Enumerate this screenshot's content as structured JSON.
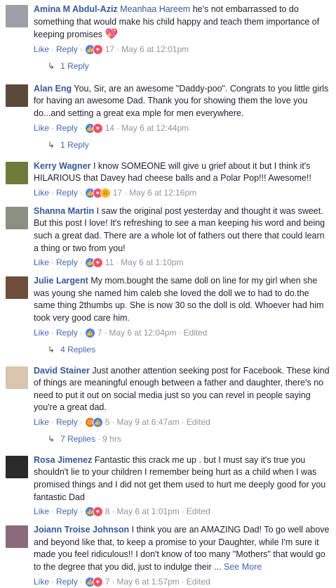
{
  "comments": [
    {
      "author": "Amina M Abdul-Aziz",
      "mention": "Meanhaa Hareem",
      "text": " he's not embarrassed to do something that would make his child happy and teach them importance of keeping promises ",
      "emoji": "💖",
      "like": "Like",
      "reply": "Reply",
      "reactions": [
        "like",
        "love"
      ],
      "count": "17",
      "time": "May 6 at 12:01pm",
      "replies": "1 Reply",
      "avatar_color": "#9aa0a6"
    },
    {
      "author": "Alan Eng",
      "text": " You, Sir, are an awesome \"Daddy-poo\". Congrats to you little girls for having an awesome Dad. Thank you for showing them the love you do...and setting a great exa mple for men everywhere.",
      "like": "Like",
      "reply": "Reply",
      "reactions": [
        "like",
        "love"
      ],
      "count": "14",
      "time": "May 6 at 12:44pm",
      "replies": "1 Reply",
      "avatar_color": "#5b4a3a"
    },
    {
      "author": "Kerry Wagner",
      "text": " I know SOMEONE will give u grief about it but I think it's HILARIOUS that Davey had cheese balls and a Polar Pop!!! Awesome!!",
      "like": "Like",
      "reply": "Reply",
      "reactions": [
        "like",
        "love",
        "haha"
      ],
      "count": "17",
      "time": "May 6 at 12:16pm",
      "avatar_color": "#6e7a3a"
    },
    {
      "author": "Shanna Martin",
      "text": " I saw the original post yesterday and thought it was sweet. But this post I love! It's refreshing to see a man keeping his word and being such a great dad. There are a whole lot of fathers out there that could learn a thing or two from you!",
      "like": "Like",
      "reply": "Reply",
      "reactions": [
        "like",
        "love"
      ],
      "count": "11",
      "time": "May 6 at 1:10pm",
      "avatar_color": "#8a8f80"
    },
    {
      "author": "Julie Largent",
      "text": " My mom.bought the same doll on line for my girl when she was young she named him caleb she loved the doll we to had to do.the same thing 2thumbs up. She is now 30 so the doll is old. Whoever had him took very good care him.",
      "like": "Like",
      "reply": "Reply",
      "reactions": [
        "like"
      ],
      "count": "7",
      "time": "May 6 at 12:04pm",
      "edited": "Edited",
      "replies": "4 Replies",
      "avatar_color": "#6d4e3c"
    },
    {
      "author": "David Stainer",
      "text": " Just another attention seeking post for Facebook. These kind of things are meaningful enough between a father and daughter, there's no need to put it out on social media just so you can revel in people saying you're a great dad.",
      "like": "Like",
      "reply": "Reply",
      "reactions": [
        "angry",
        "like"
      ],
      "count": "5",
      "time": "May 9 at 6:47am",
      "edited": "Edited",
      "replies": "7 Replies",
      "replies_age": "9 hrs",
      "avatar_color": "#d9c4b0"
    },
    {
      "author": "Rosa Jimenez",
      "text": " Fantastic this crack me up . but I must say it's true you shouldn't lie to your children I remember being hurt as a child when I was promised things and I did not get them used to hurt me deeply good for you fantastic Dad",
      "like": "Like",
      "reply": "Reply",
      "reactions": [
        "like",
        "love"
      ],
      "count": "8",
      "time": "May 6 at 1:01pm",
      "edited": "Edited",
      "avatar_color": "#2a2a2a"
    },
    {
      "author": "Joiann Troise Johnson",
      "text": " I think you are an AMAZING Dad! To go well above and beyond like that, to keep a promise to your Daughter, while I'm sure it made you feel ridiculous!! I don't know of too many \"Mothers\" that would go to the degree that you did, just to indulge their ... ",
      "see_more": "See More",
      "like": "Like",
      "reply": "Reply",
      "reactions": [
        "like",
        "love"
      ],
      "count": "7",
      "time": "May 6 at 1:57pm",
      "edited": "Edited",
      "avatar_color": "#8a6a7a"
    }
  ],
  "icons": {
    "reply_arrow": "↳",
    "dot": "·"
  }
}
